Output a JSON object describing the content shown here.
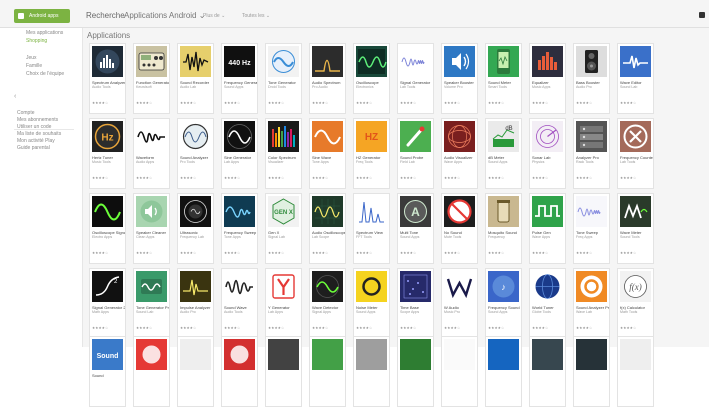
{
  "topbar": {
    "brand_label": "Android apps",
    "search_label": "Recherche",
    "breadcrumb": "Applications Android ⌄",
    "filter1": "Plus de ⌄",
    "filter2": "Toutes les ⌄"
  },
  "sidebar": {
    "primary": [
      "Mes applications",
      "Shopping"
    ],
    "secondary": [
      "Jeux",
      "Famille",
      "Choix de l'équipe"
    ],
    "account": [
      "Compte",
      "Mes abonnements",
      "Utiliser un code",
      "Ma liste de souhaits",
      "Mon activité Play",
      "Guide parental"
    ]
  },
  "main": {
    "title": "Applications"
  },
  "apps": [
    {
      "name": "Spectrum Analyzer",
      "dev": "Audio Tools",
      "bg": "#1e2a36",
      "icon": "bars",
      "fg": "#ffffff",
      "stars": "★★★★☆",
      "price": ""
    },
    {
      "name": "Function Generator",
      "dev": "Keuwlsoft",
      "bg": "#c9c2a2",
      "icon": "device",
      "fg": "#333333",
      "stars": "★★★★☆",
      "price": ""
    },
    {
      "name": "Sound Recorder",
      "dev": "Audio Lab",
      "bg": "#e6cf6c",
      "icon": "noise",
      "fg": "#111111",
      "stars": "★★★★☆",
      "price": ""
    },
    {
      "name": "Frequency Generator",
      "dev": "Sound Apps",
      "bg": "#101010",
      "icon": "text",
      "fg": "#ffffff",
      "text": "440 Hz",
      "stars": "★★★★☆",
      "price": ""
    },
    {
      "name": "Tone Generator",
      "dev": "Droid Tools",
      "bg": "#f2f2f2",
      "icon": "circle-wave",
      "fg": "#3a8dd6",
      "stars": "★★★★☆",
      "price": ""
    },
    {
      "name": "Audio Spectrum",
      "dev": "Pro Audio",
      "bg": "#2c2c2c",
      "icon": "peak",
      "fg": "#e8b44a",
      "stars": "★★★★☆",
      "price": ""
    },
    {
      "name": "Oscilloscope",
      "dev": "Electronics",
      "bg": "#19493a",
      "icon": "scope",
      "fg": "#5ef07a",
      "stars": "★★★★☆",
      "price": ""
    },
    {
      "name": "Signal Generator",
      "dev": "Lab Tools",
      "bg": "#ffffff",
      "icon": "chirp",
      "fg": "#7d84d8",
      "stars": "★★★★☆",
      "price": ""
    },
    {
      "name": "Speaker Booster",
      "dev": "Volume Pro",
      "bg": "#2e78c4",
      "icon": "speaker",
      "fg": "#ffffff",
      "stars": "★★★★☆",
      "price": ""
    },
    {
      "name": "Sound Meter",
      "dev": "Smart Tools",
      "bg": "#34a853",
      "icon": "phone",
      "fg": "#c8f0b0",
      "stars": "★★★★☆",
      "price": ""
    },
    {
      "name": "Equalizer",
      "dev": "Music Apps",
      "bg": "#2e2e3e",
      "icon": "eq",
      "fg": "#e85d3a",
      "stars": "★★★★☆",
      "price": ""
    },
    {
      "name": "Bass Booster",
      "dev": "Audio Pro",
      "bg": "#dddddd",
      "icon": "speaker-box",
      "fg": "#222222",
      "stars": "★★★★☆",
      "price": ""
    },
    {
      "name": "Wave Editor",
      "dev": "Sound Lab",
      "bg": "#3a70c9",
      "icon": "pulse",
      "fg": "#ffffff",
      "stars": "★★★★☆",
      "price": ""
    },
    {
      "name": "Hertz Tuner",
      "dev": "Music Tools",
      "bg": "#222222",
      "icon": "hz-circle",
      "fg": "#e8a43a",
      "text": "Hz",
      "stars": "★★★★☆",
      "price": ""
    },
    {
      "name": "Waveform",
      "dev": "Audio Apps",
      "bg": "#ffffff",
      "icon": "squiggle",
      "fg": "#111111",
      "stars": "★★★★☆",
      "price": ""
    },
    {
      "name": "Sound Analyzer",
      "dev": "Pro Tools",
      "bg": "#ffffff",
      "icon": "scope-round",
      "fg": "#333333",
      "stars": "★★★★☆",
      "price": ""
    },
    {
      "name": "Sine Generator",
      "dev": "Lab Apps",
      "bg": "#111111",
      "icon": "sine-round",
      "fg": "#ffffff",
      "stars": "★★★★☆",
      "price": ""
    },
    {
      "name": "Color Spectrum",
      "dev": "Visualizer",
      "bg": "#1a1a1a",
      "icon": "rainbow",
      "fg": "#ffffff",
      "stars": "★★★★☆",
      "price": ""
    },
    {
      "name": "Sine Wave",
      "dev": "Tone Apps",
      "bg": "#e77a2a",
      "icon": "sine",
      "fg": "#ffffff",
      "stars": "★★★★☆",
      "price": ""
    },
    {
      "name": "HZ Generator",
      "dev": "Freq Tools",
      "bg": "#f5a524",
      "icon": "text",
      "fg": "#e2541a",
      "text": "HZ",
      "stars": "★★★★☆",
      "price": ""
    },
    {
      "name": "Sound Probe",
      "dev": "Field Lab",
      "bg": "#4caf50",
      "icon": "probe",
      "fg": "#ffffff",
      "stars": "★★★★☆",
      "price": ""
    },
    {
      "name": "Audio Visualizer",
      "dev": "Wave Apps",
      "bg": "#7a1f1f",
      "icon": "mesh",
      "fg": "#f08060",
      "stars": "★★★★☆",
      "price": ""
    },
    {
      "name": "dB Meter",
      "dev": "Sound Apps",
      "bg": "#eaeaea",
      "icon": "db",
      "fg": "#2a9a3a",
      "text": "dB",
      "stars": "★★★★☆",
      "price": ""
    },
    {
      "name": "Sonar Lab",
      "dev": "Physics",
      "bg": "#f3eef5",
      "icon": "sonar",
      "fg": "#a14fc1",
      "stars": "★★★★☆",
      "price": ""
    },
    {
      "name": "Analyzer Pro",
      "dev": "Rack Tools",
      "bg": "#555555",
      "icon": "rack",
      "fg": "#dddddd",
      "stars": "★★★★☆",
      "price": ""
    },
    {
      "name": "Frequency Counter",
      "dev": "Lab Tools",
      "bg": "#a46a5a",
      "icon": "x-circle",
      "fg": "#ffffff",
      "stars": "★★★★☆",
      "price": ""
    },
    {
      "name": "Oscilloscope Signal",
      "dev": "Electro Apps",
      "bg": "#0d0d0d",
      "icon": "scope-green",
      "fg": "#6cff3a",
      "stars": "★★★★☆",
      "price": ""
    },
    {
      "name": "Speaker Cleaner",
      "dev": "Clean Apps",
      "bg": "#a8d5b0",
      "icon": "speaker-round",
      "fg": "#ffffff",
      "stars": "★★★★☆",
      "price": ""
    },
    {
      "name": "Ultrasonic",
      "dev": "Frequency Lab",
      "bg": "#111111",
      "icon": "seal",
      "fg": "#e0e0e0",
      "stars": "★★★★☆",
      "price": ""
    },
    {
      "name": "Frequency Sweep",
      "dev": "Tone Apps",
      "bg": "#0f3b52",
      "icon": "sweep",
      "fg": "#7ad4ff",
      "stars": "★★★★☆",
      "price": ""
    },
    {
      "name": "Gen X",
      "dev": "Signal Lab",
      "bg": "#f2f2f2",
      "icon": "hex",
      "fg": "#2e8a3a",
      "text": "GEN X",
      "stars": "★★★★☆",
      "price": ""
    },
    {
      "name": "Audio Oscilloscope",
      "dev": "Lab Scope",
      "bg": "#1f3a2a",
      "icon": "grid-wave",
      "fg": "#f5e86a",
      "stars": "★★★★☆",
      "price": ""
    },
    {
      "name": "Spectrum View",
      "dev": "FFT Tools",
      "bg": "#ffffff",
      "icon": "fft",
      "fg": "#3a66c9",
      "stars": "★★★★☆",
      "price": ""
    },
    {
      "name": "Multi Tone",
      "dev": "Sound Apps",
      "bg": "#3a3a3a",
      "icon": "a-circle",
      "fg": "#cfe8cf",
      "stars": "★★★★☆",
      "price": ""
    },
    {
      "name": "No Sound",
      "dev": "Mute Tools",
      "bg": "#1e1e1e",
      "icon": "no",
      "fg": "#e53935",
      "stars": "★★★★☆",
      "price": ""
    },
    {
      "name": "Mosquito Sound",
      "dev": "Frequency",
      "bg": "#c9b890",
      "icon": "jar",
      "fg": "#6b5a2a",
      "stars": "★★★★☆",
      "price": ""
    },
    {
      "name": "Pulse Gen",
      "dev": "Wave Apps",
      "bg": "#2fa34a",
      "icon": "square",
      "fg": "#ffffff",
      "stars": "★★★★☆",
      "price": ""
    },
    {
      "name": "Tone Sweep",
      "dev": "Freq Apps",
      "bg": "#f7f7fb",
      "icon": "chirp",
      "fg": "#8a8fe0",
      "stars": "★★★★☆",
      "price": ""
    },
    {
      "name": "Wave Meter",
      "dev": "Sound Tools",
      "bg": "#2a3a2a",
      "icon": "m-wave",
      "fg": "#ffffff",
      "stars": "★★★★☆",
      "price": ""
    },
    {
      "name": "Signal Generator 2",
      "dev": "Math Apps",
      "bg": "#111111",
      "icon": "curve",
      "fg": "#ffffff",
      "stars": "★★★★☆",
      "price": ""
    },
    {
      "name": "Tone Generator Pro",
      "dev": "Sound Lab",
      "bg": "#3a9a6a",
      "icon": "wave-box",
      "fg": "#ffffff",
      "stars": "★★★★☆",
      "price": ""
    },
    {
      "name": "Impulse Analyzer",
      "dev": "Audio Pro",
      "bg": "#3a3410",
      "icon": "spark",
      "fg": "#f5e86a",
      "stars": "★★★★☆",
      "price": ""
    },
    {
      "name": "Sound Wave",
      "dev": "Audio Tools",
      "bg": "#ffffff",
      "icon": "bw-wave",
      "fg": "#222222",
      "stars": "★★★★☆",
      "price": ""
    },
    {
      "name": "Y Generator",
      "dev": "Lab Apps",
      "bg": "#ffffff",
      "icon": "y",
      "fg": "#e53935",
      "stars": "★★★★☆",
      "price": ""
    },
    {
      "name": "Wave Detector",
      "dev": "Signal Apps",
      "bg": "#1e1e1e",
      "icon": "sine-green",
      "fg": "#6cff3a",
      "stars": "★★★★☆",
      "price": ""
    },
    {
      "name": "Noise Meter",
      "dev": "Sound Apps",
      "bg": "#f5d31f",
      "icon": "ring",
      "fg": "#222222",
      "stars": "★★★★☆",
      "price": ""
    },
    {
      "name": "Time Base",
      "dev": "Scope Apps",
      "bg": "#262a6a",
      "icon": "dots",
      "fg": "#9aa0ff",
      "stars": "★★★★☆",
      "price": ""
    },
    {
      "name": "W Audio",
      "dev": "Music Pro",
      "bg": "#ffffff",
      "icon": "w",
      "fg": "#1a1a4a",
      "stars": "★★★★☆",
      "price": ""
    },
    {
      "name": "Frequency Sound",
      "dev": "Sound Apps",
      "bg": "#3a66c9",
      "icon": "globe",
      "fg": "#ffffff",
      "stars": "★★★★☆",
      "price": ""
    },
    {
      "name": "World Tuner",
      "dev": "Globe Tools",
      "bg": "#ffffff",
      "icon": "globe-dark",
      "fg": "#1a3a8a",
      "stars": "★★★★☆",
      "price": ""
    },
    {
      "name": "Sound Analyzer Pro",
      "dev": "Wave Lab",
      "bg": "#f08a24",
      "icon": "orange-ring",
      "fg": "#ffffff",
      "stars": "★★★★☆",
      "price": ""
    },
    {
      "name": "f(x) Calculator",
      "dev": "Math Tools",
      "bg": "#f2f2f2",
      "icon": "fx",
      "fg": "#555555",
      "text": "f(x)",
      "stars": "★★★★☆",
      "price": ""
    },
    {
      "name": "Sound",
      "dev": "",
      "bg": "#3a7ac9",
      "icon": "text",
      "fg": "#ffffff",
      "text": "Sound",
      "stars": "",
      "price": ""
    },
    {
      "name": "",
      "dev": "",
      "bg": "#e53935",
      "icon": "circle",
      "fg": "#ffffff",
      "stars": "",
      "price": ""
    },
    {
      "name": "",
      "dev": "",
      "bg": "#eeeeee",
      "icon": "blank",
      "fg": "#aaaaaa",
      "stars": "",
      "price": ""
    },
    {
      "name": "",
      "dev": "",
      "bg": "#d32f2f",
      "icon": "circle",
      "fg": "#ffffff",
      "stars": "",
      "price": ""
    },
    {
      "name": "",
      "dev": "",
      "bg": "#424242",
      "icon": "blank",
      "fg": "#ffffff",
      "stars": "",
      "price": ""
    },
    {
      "name": "",
      "dev": "",
      "bg": "#43a047",
      "icon": "blank",
      "fg": "#ffffff",
      "stars": "",
      "price": ""
    },
    {
      "name": "",
      "dev": "",
      "bg": "#9e9e9e",
      "icon": "blank",
      "fg": "#ffffff",
      "stars": "",
      "price": ""
    },
    {
      "name": "",
      "dev": "",
      "bg": "#2e7d32",
      "icon": "blank",
      "fg": "#ffffff",
      "stars": "",
      "price": ""
    },
    {
      "name": "",
      "dev": "",
      "bg": "#fafafa",
      "icon": "blank",
      "fg": "#ffffff",
      "stars": "",
      "price": ""
    },
    {
      "name": "",
      "dev": "",
      "bg": "#1565c0",
      "icon": "blank",
      "fg": "#ffffff",
      "stars": "",
      "price": ""
    },
    {
      "name": "",
      "dev": "",
      "bg": "#37474f",
      "icon": "blank",
      "fg": "#ffffff",
      "stars": "",
      "price": ""
    },
    {
      "name": "",
      "dev": "",
      "bg": "#263238",
      "icon": "blank",
      "fg": "#ffffff",
      "stars": "",
      "price": ""
    },
    {
      "name": "",
      "dev": "",
      "bg": "#eeeeee",
      "icon": "blank",
      "fg": "#ffffff",
      "stars": "",
      "price": ""
    }
  ]
}
